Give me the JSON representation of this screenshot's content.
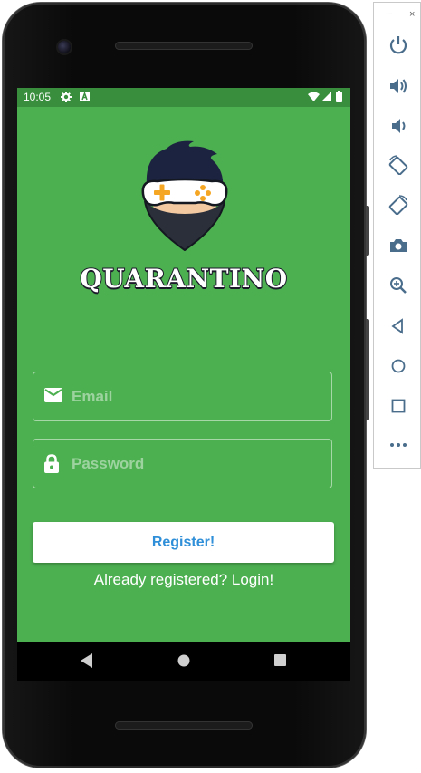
{
  "status_bar": {
    "time": "10:05",
    "icons": [
      "settings-icon",
      "a-icon",
      "wifi-icon",
      "signal-icon",
      "battery-icon"
    ]
  },
  "app": {
    "title": "QUARANTINO",
    "email_placeholder": "Email",
    "password_placeholder": "Password",
    "register_label": "Register!",
    "login_link": "Already registered? Login!",
    "colors": {
      "background": "#4caf50",
      "status_bar": "#388e3c",
      "button_text": "#2f8fd8",
      "logo_accent": "#f5a623"
    }
  },
  "nav_bar": {
    "buttons": [
      "back-icon",
      "home-icon",
      "recents-icon"
    ]
  },
  "emulator_toolbar": {
    "window_controls": [
      "−",
      "×"
    ],
    "buttons": [
      "power-icon",
      "volume-up-icon",
      "volume-down-icon",
      "rotate-left-icon",
      "rotate-right-icon",
      "camera-icon",
      "zoom-icon",
      "back-icon",
      "home-icon",
      "overview-icon",
      "more-icon"
    ]
  }
}
